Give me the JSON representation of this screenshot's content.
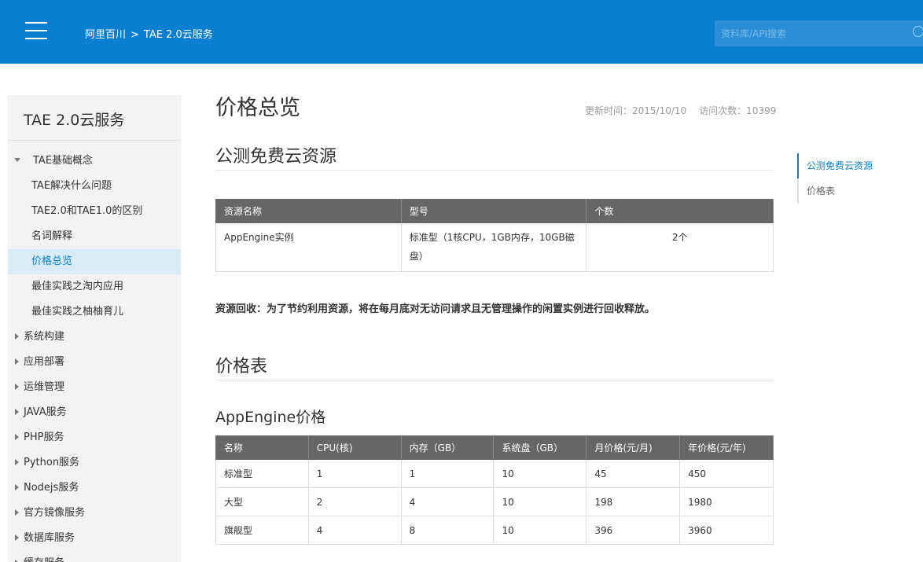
{
  "header": {
    "breadcrumb": [
      "阿里百川",
      "TAE 2.0云服务"
    ],
    "breadcrumb_sep": ">",
    "search_placeholder": "资料库/API搜索",
    "bg_color": "#0a7fcf"
  },
  "sidebar": {
    "title": "TAE 2.0云服务",
    "items": [
      {
        "label": "TAE基础概念",
        "level": "top",
        "expanded": true
      },
      {
        "label": "TAE解决什么问题",
        "level": "sub"
      },
      {
        "label": "TAE2.0和TAE1.0的区别",
        "level": "sub"
      },
      {
        "label": "名词解释",
        "level": "sub"
      },
      {
        "label": "价格总览",
        "level": "sub",
        "active": true
      },
      {
        "label": "最佳实践之淘内应用",
        "level": "sub"
      },
      {
        "label": "最佳实践之柚柚育儿",
        "level": "sub"
      },
      {
        "label": "系统构建",
        "level": "top"
      },
      {
        "label": "应用部署",
        "level": "top"
      },
      {
        "label": "运维管理",
        "level": "top"
      },
      {
        "label": "JAVA服务",
        "level": "top"
      },
      {
        "label": "PHP服务",
        "level": "top"
      },
      {
        "label": "Python服务",
        "level": "top"
      },
      {
        "label": "Nodejs服务",
        "level": "top"
      },
      {
        "label": "官方镜像服务",
        "level": "top"
      },
      {
        "label": "数据库服务",
        "level": "top"
      },
      {
        "label": "缓存服务",
        "level": "top"
      }
    ]
  },
  "main": {
    "title": "价格总览",
    "updated": "更新时间：2015/10/10",
    "visits": "访问次数：10399",
    "section1": "公测免费云资源",
    "table1": {
      "headers": [
        "资源名称",
        "型号",
        "个数"
      ],
      "rows": [
        [
          "AppEngine实例",
          "标准型（1核CPU，1GB内存，10GB磁盘）",
          "2个"
        ]
      ]
    },
    "notice": "资源回收：为了节约利用资源，将在每月底对无访问请求且无管理操作的闲置实例进行回收释放。",
    "section2": "价格表",
    "subsection": "AppEngine价格",
    "table2": {
      "headers": [
        "名称",
        "CPU(核)",
        "内存（GB）",
        "系统盘（GB）",
        "月价格(元/月)",
        "年价格(元/年)"
      ],
      "rows": [
        [
          "标准型",
          "1",
          "1",
          "10",
          "45",
          "450"
        ],
        [
          "大型",
          "2",
          "4",
          "10",
          "198",
          "1980"
        ],
        [
          "旗舰型",
          "4",
          "8",
          "10",
          "396",
          "3960"
        ]
      ]
    }
  },
  "toc": {
    "items": [
      {
        "label": "公测免费云资源",
        "active": true
      },
      {
        "label": "价格表"
      }
    ]
  }
}
